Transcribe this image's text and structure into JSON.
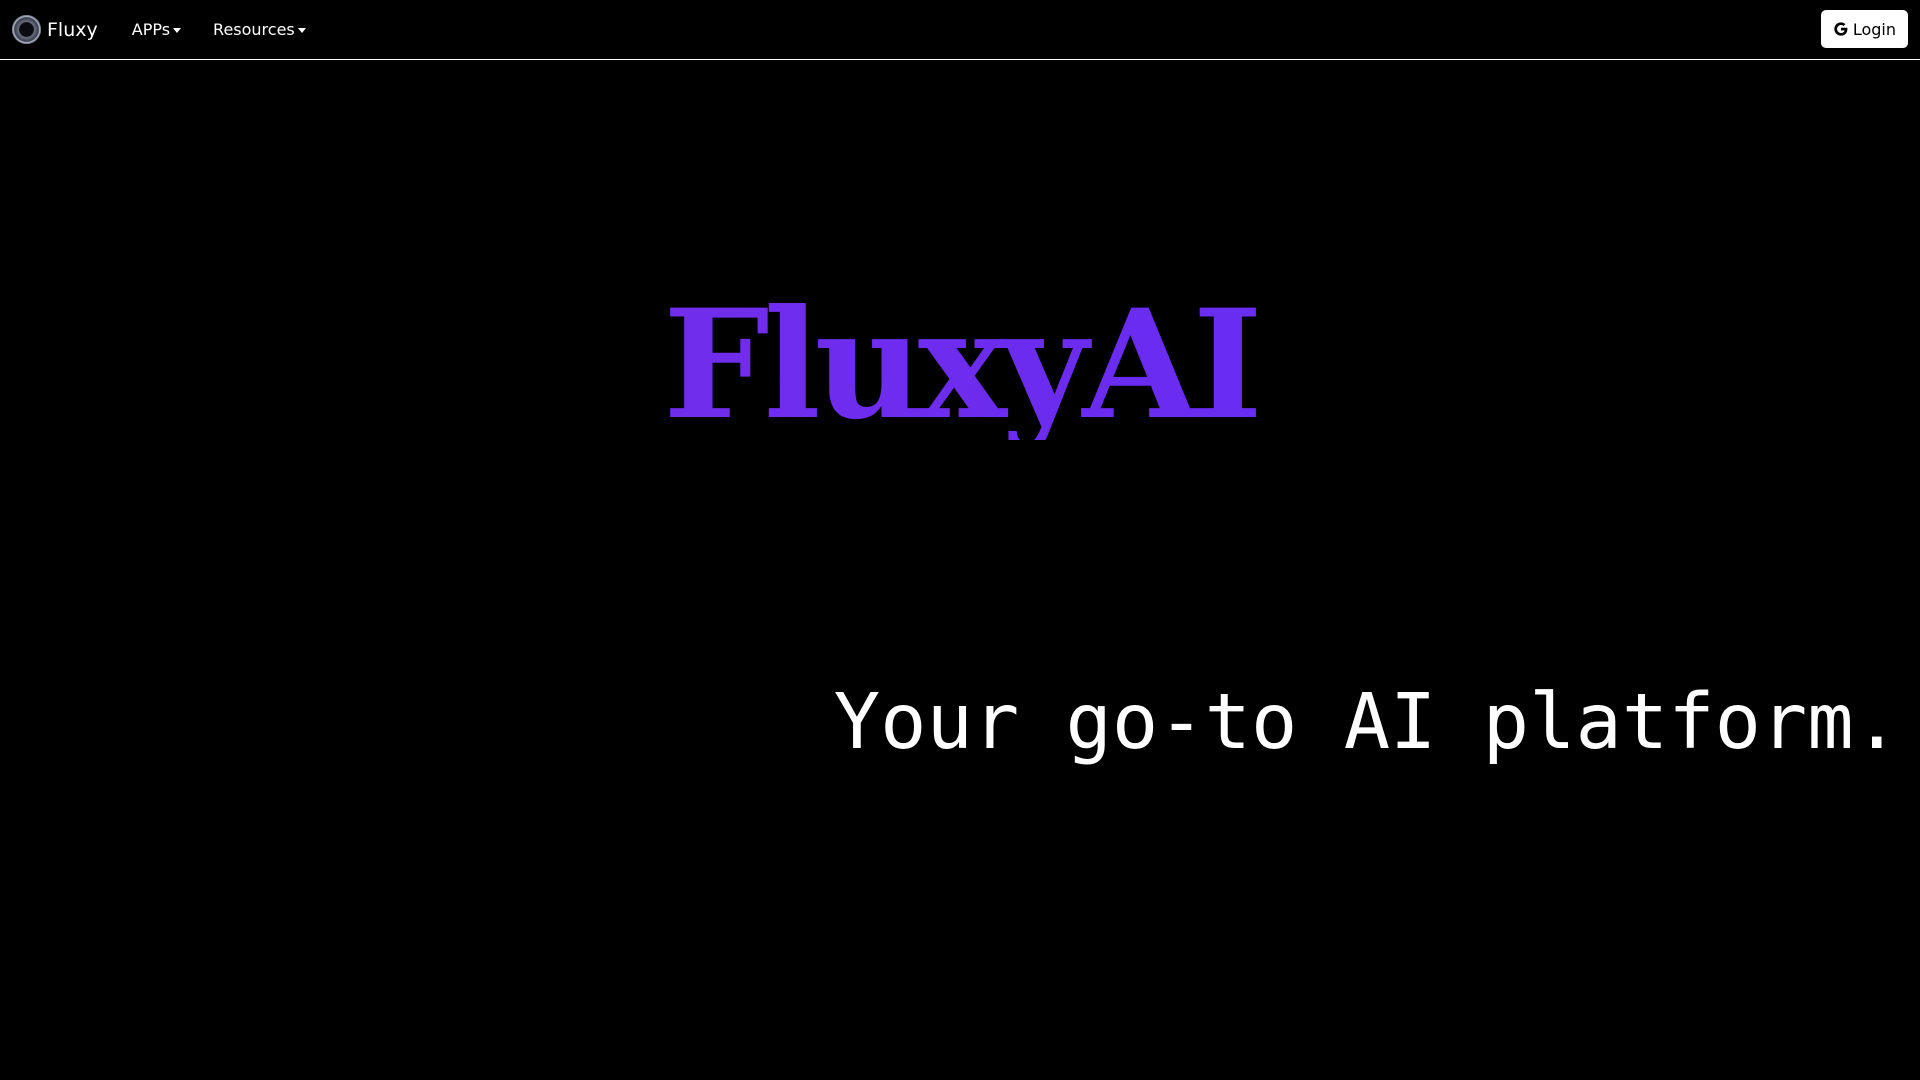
{
  "navbar": {
    "brand": "Fluxy",
    "items": [
      {
        "label": "APPs"
      },
      {
        "label": "Resources"
      }
    ],
    "login_label": "Login"
  },
  "hero": {
    "title": "FluxyAI",
    "tagline": "Your go-to AI platform."
  },
  "colors": {
    "background": "#000000",
    "accent": "#6a2cf0",
    "text": "#ffffff"
  },
  "icons": {
    "brand": "fluxy-logo-icon",
    "dropdown": "caret-down-icon",
    "login": "google-g-icon"
  }
}
